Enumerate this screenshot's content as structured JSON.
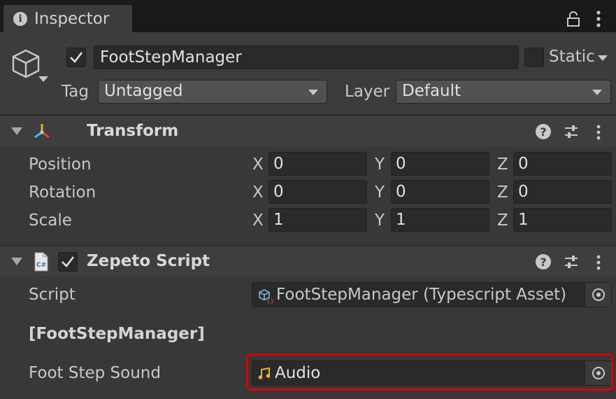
{
  "tab": {
    "title": "Inspector"
  },
  "header": {
    "active": true,
    "name": "FootStepManager",
    "static_label": "Static",
    "tag_label": "Tag",
    "tag_value": "Untagged",
    "layer_label": "Layer",
    "layer_value": "Default"
  },
  "transform": {
    "title": "Transform",
    "rows": [
      {
        "label": "Position",
        "x": "0",
        "y": "0",
        "z": "0"
      },
      {
        "label": "Rotation",
        "x": "0",
        "y": "0",
        "z": "0"
      },
      {
        "label": "Scale",
        "x": "1",
        "y": "1",
        "z": "1"
      }
    ],
    "axis": {
      "x": "X",
      "y": "Y",
      "z": "Z"
    }
  },
  "zepeto": {
    "title": "Zepeto Script",
    "enabled": true,
    "script_label": "Script",
    "script_value": "FootStepManager (Typescript Asset)",
    "section_label": "[FootStepManager]",
    "footstep_label": "Foot Step Sound",
    "footstep_value": "Audio"
  },
  "icons": {
    "tab": "info-icon",
    "lock": "lock-icon",
    "menu": "kebab-menu-icon",
    "gameobject": "cube-icon",
    "transform": "transform-axes-icon",
    "script": "csharp-script-icon",
    "asset": "typescript-asset-icon",
    "audio": "music-note-icon",
    "picker": "object-picker-icon",
    "help": "help-icon",
    "presets": "presets-icon"
  },
  "colors": {
    "highlight": "#d60000",
    "background": "#383838"
  }
}
